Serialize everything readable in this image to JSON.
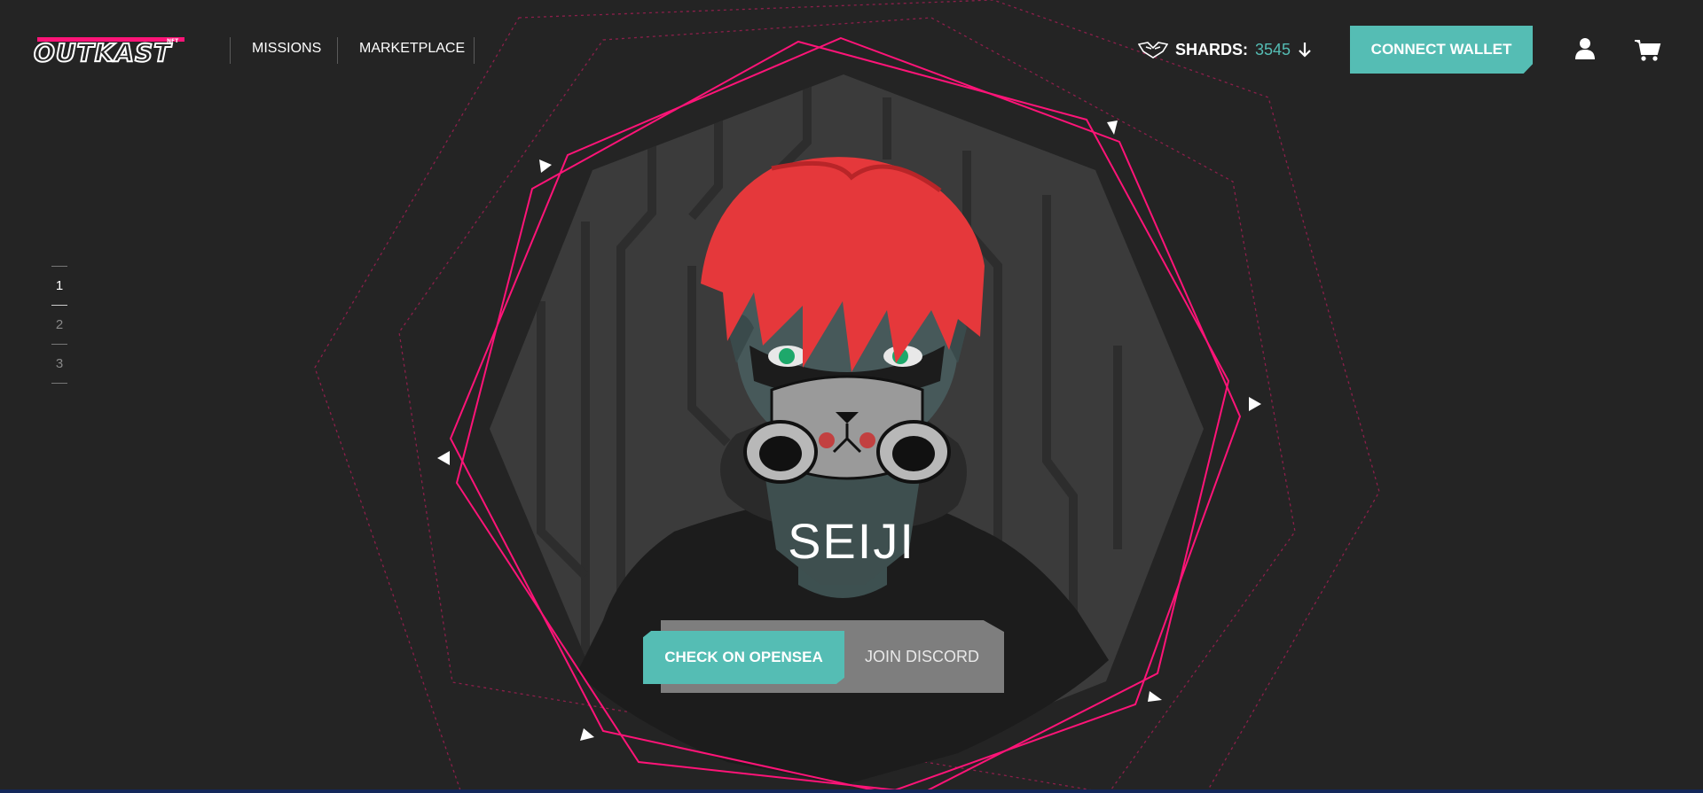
{
  "brand": {
    "logo_text": "OUTKAST",
    "logo_superscript": "NFT",
    "accent": "#ff1478",
    "teal": "#55bdb4"
  },
  "nav": {
    "items": [
      {
        "label": "MISSIONS"
      },
      {
        "label": "MARKETPLACE"
      }
    ]
  },
  "shards": {
    "label": "SHARDS:",
    "value": "3545",
    "icon": "shard-mask-icon",
    "dropdown_icon": "arrow-down-icon"
  },
  "header": {
    "connect_wallet": "CONNECT WALLET",
    "account_icon": "user-icon",
    "cart_icon": "cart-icon"
  },
  "pager": {
    "pages": [
      "1",
      "2",
      "3"
    ],
    "active": "1"
  },
  "hero": {
    "character_name": "SEIJI",
    "character_art": "red-haired character wearing gas mask and hoodie",
    "primary_cta": "CHECK ON OPENSEA",
    "secondary_cta": "JOIN DISCORD"
  }
}
